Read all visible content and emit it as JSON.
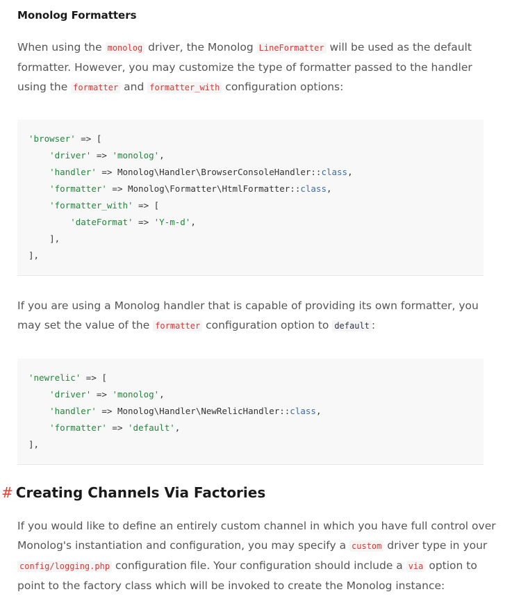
{
  "monolog_formatters": {
    "heading": "Monolog Formatters",
    "para1": {
      "t1": "When using the ",
      "c1": "monolog",
      "t2": " driver, the Monolog ",
      "c2": "LineFormatter",
      "t3": " will be used as the default formatter. However, you may customize the type of formatter passed to the handler using the ",
      "c3": "formatter",
      "t4": " and ",
      "c4": "formatter_with",
      "t5": " configuration options:"
    },
    "code1": {
      "l1_key": "'browser'",
      "l1_rest": " => [",
      "l2_key": "'driver'",
      "l2_arrow": " => ",
      "l2_val": "'monolog'",
      "l2_end": ",",
      "l3_key": "'handler'",
      "l3_arrow": " => Monolog\\Handler\\BrowserConsoleHandler::",
      "l3_kw": "class",
      "l3_end": ",",
      "l4_key": "'formatter'",
      "l4_arrow": " => Monolog\\Formatter\\HtmlFormatter::",
      "l4_kw": "class",
      "l4_end": ",",
      "l5_key": "'formatter_with'",
      "l5_rest": " => [",
      "l6_key": "'dateFormat'",
      "l6_arrow": " => ",
      "l6_val": "'Y-m-d'",
      "l6_end": ",",
      "l7": "],",
      "l8": "],"
    },
    "para2": {
      "t1": "If you are using a Monolog handler that is capable of providing its own formatter, you may set the value of the ",
      "c1": "formatter",
      "t2": " configuration option to ",
      "c2": "default",
      "t3": ":"
    },
    "code2": {
      "l1_key": "'newrelic'",
      "l1_rest": " => [",
      "l2_key": "'driver'",
      "l2_arrow": " => ",
      "l2_val": "'monolog'",
      "l2_end": ",",
      "l3_key": "'handler'",
      "l3_arrow": " => Monolog\\Handler\\NewRelicHandler::",
      "l3_kw": "class",
      "l3_end": ",",
      "l4_key": "'formatter'",
      "l4_arrow": " => ",
      "l4_val": "'default'",
      "l4_end": ",",
      "l5": "],"
    }
  },
  "creating_channels": {
    "hash": "#",
    "heading": "Creating Channels Via Factories",
    "para": {
      "t1": "If you would like to define an entirely custom channel in which you have full control over Monolog's instantiation and configuration, you may specify a ",
      "c1": "custom",
      "t2": " driver type in your ",
      "c2": "config/logging.php",
      "t3": " configuration file. Your configuration should include a ",
      "c3": "via",
      "t4": " option to point to the factory class which will be invoked to create the Monolog instance:"
    }
  },
  "colors": {
    "inline_code": "#e3342f",
    "string": "#22863a",
    "keyword": "#3b6ca8",
    "hash_accent": "#ef3b2d",
    "code_bg": "#f8f8f8"
  }
}
